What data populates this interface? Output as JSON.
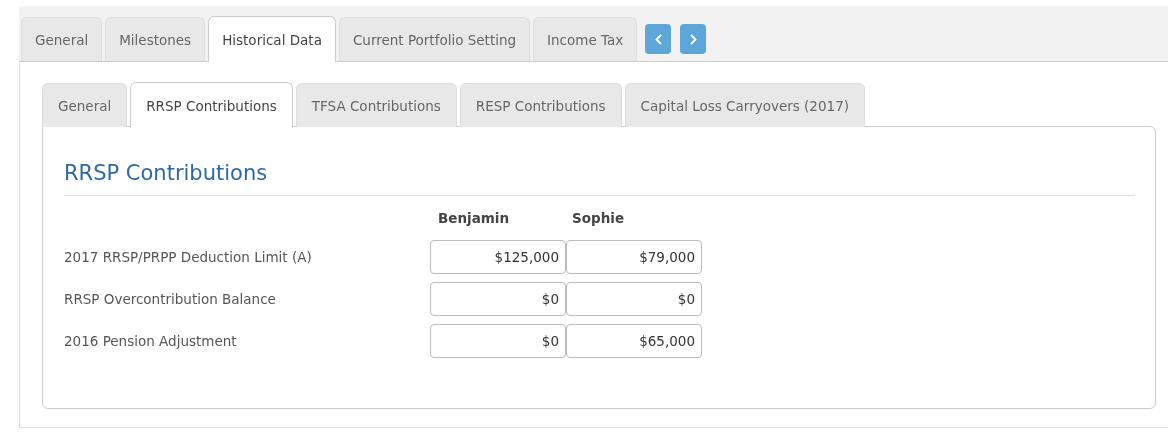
{
  "tabs": [
    {
      "label": "General",
      "selected": false
    },
    {
      "label": "Milestones",
      "selected": false
    },
    {
      "label": "Historical Data",
      "selected": true
    },
    {
      "label": "Current Portfolio Setting",
      "selected": false
    },
    {
      "label": "Income Tax",
      "selected": false
    }
  ],
  "subtabs": [
    {
      "label": "General",
      "selected": false
    },
    {
      "label": "RRSP Contributions",
      "selected": true
    },
    {
      "label": "TFSA Contributions",
      "selected": false
    },
    {
      "label": "RESP Contributions",
      "selected": false
    },
    {
      "label": "Capital Loss Carryovers (2017)",
      "selected": false
    }
  ],
  "section": {
    "title": "RRSP Contributions",
    "columns": [
      "Benjamin",
      "Sophie"
    ],
    "rows": [
      {
        "label": "2017 RRSP/PRPP Deduction Limit (A)",
        "values": [
          "$125,000",
          "$79,000"
        ]
      },
      {
        "label": "RRSP Overcontribution Balance",
        "values": [
          "$0",
          "$0"
        ]
      },
      {
        "label": "2016 Pension Adjustment",
        "values": [
          "$0",
          "$65,000"
        ]
      }
    ]
  }
}
